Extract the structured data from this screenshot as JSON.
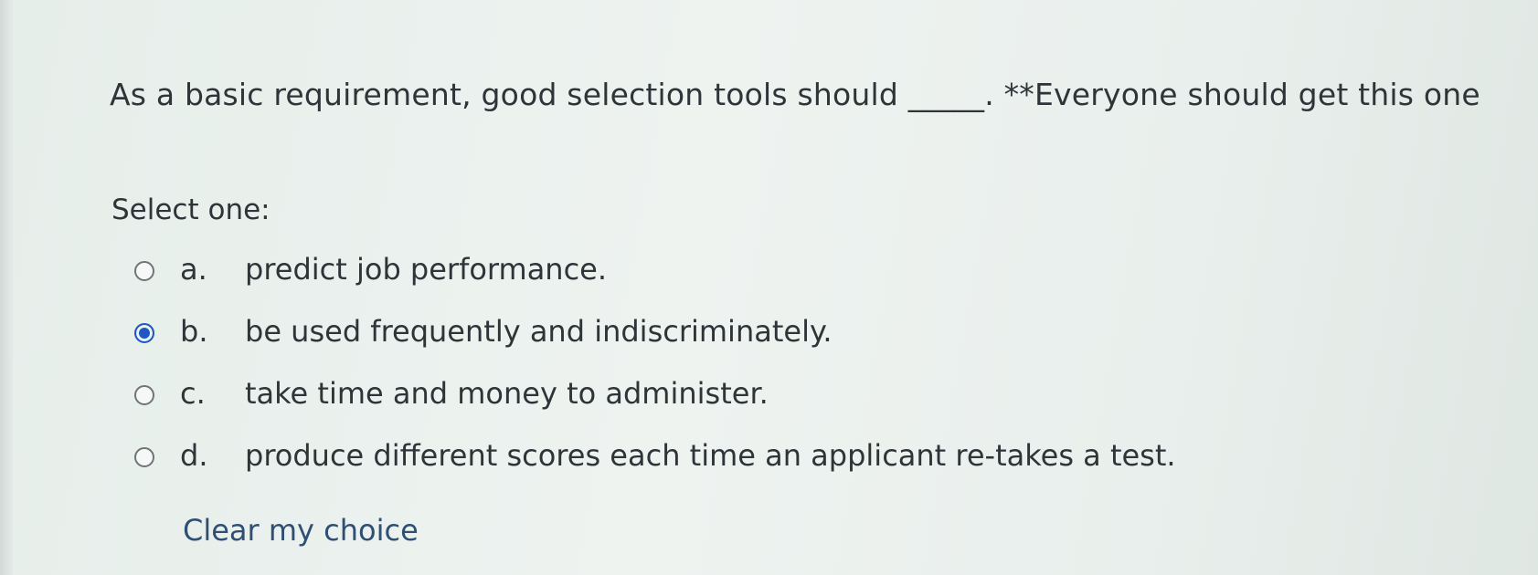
{
  "question": {
    "text": "As a basic requirement, good selection tools should _____. **Everyone should get this one",
    "select_prompt": "Select one:"
  },
  "options": [
    {
      "letter": "a.",
      "text": "predict job performance.",
      "selected": false
    },
    {
      "letter": "b.",
      "text": "be used frequently and indiscriminately.",
      "selected": true
    },
    {
      "letter": "c.",
      "text": "take time and money to administer.",
      "selected": false
    },
    {
      "letter": "d.",
      "text": "produce different scores each time an applicant re-takes a test.",
      "selected": false
    }
  ],
  "actions": {
    "clear_label": "Clear my choice"
  },
  "colors": {
    "radio_selected": "#1f57c3",
    "text": "#2e3438",
    "link": "#2f4f73"
  }
}
